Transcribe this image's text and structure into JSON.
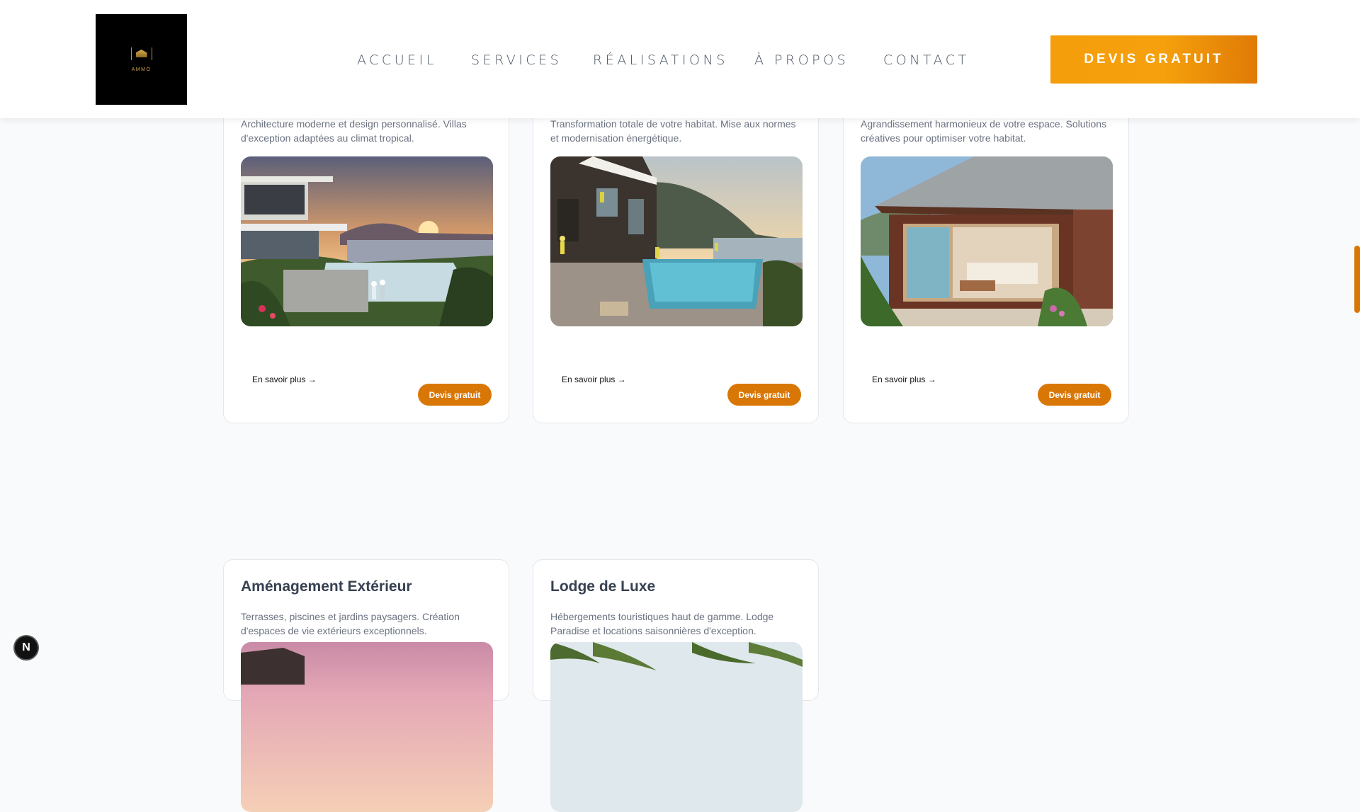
{
  "header": {
    "logo_text": "AMMO",
    "nav": [
      "ACCUEIL",
      "SERVICES",
      "RÉALISATIONS",
      "À PROPOS",
      "CONTACT"
    ],
    "cta_label": "DEVIS GRATUIT"
  },
  "cards": [
    {
      "description": "Architecture moderne et design personnalisé. Villas d'exception adaptées au climat tropical.",
      "more_label": "En savoir plus →",
      "quote_label": "Devis gratuit"
    },
    {
      "description": "Transformation totale de votre habitat. Mise aux normes et modernisation énergétique.",
      "more_label": "En savoir plus →",
      "quote_label": "Devis gratuit"
    },
    {
      "description": "Agrandissement harmonieux de votre espace. Solutions créatives pour optimiser votre habitat.",
      "more_label": "En savoir plus →",
      "quote_label": "Devis gratuit"
    },
    {
      "title": "Aménagement Extérieur",
      "description": "Terrasses, piscines et jardins paysagers. Création d'espaces de vie extérieurs exceptionnels."
    },
    {
      "title": "Lodge de Luxe",
      "description": "Hébergements touristiques haut de gamme. Lodge Paradise et locations saisonnières d'exception."
    }
  ],
  "dev_badge": "N",
  "colors": {
    "accent": "#d97706",
    "cta": "#f59e0b",
    "header_bg": "#ffffff",
    "page_bg": "#f8fafc"
  }
}
